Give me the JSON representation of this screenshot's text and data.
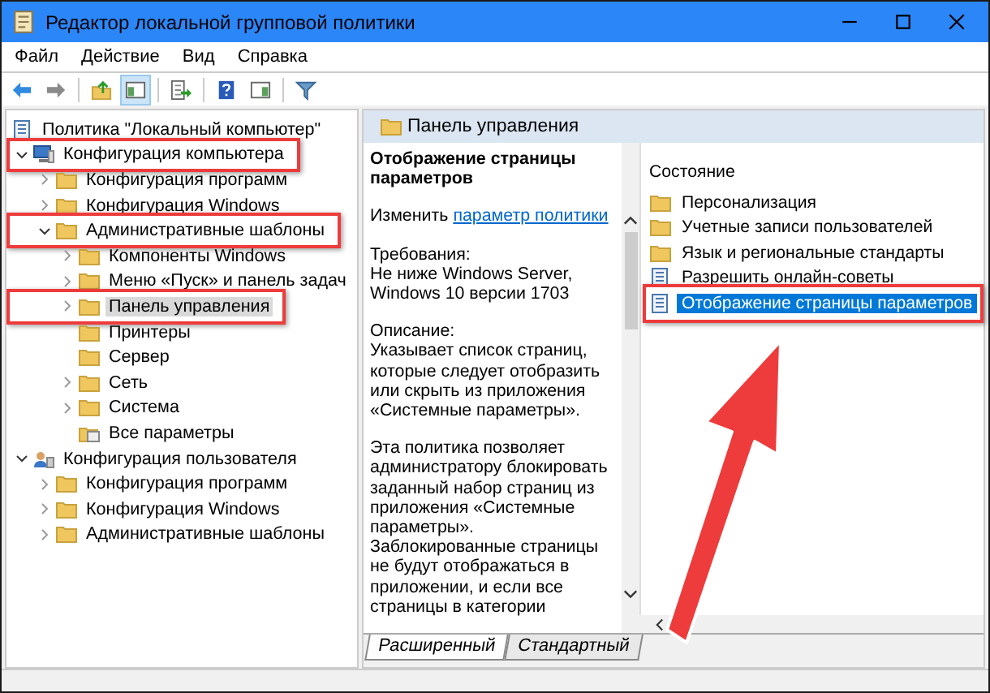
{
  "window": {
    "title": "Редактор локальной групповой политики"
  },
  "menu": [
    "Файл",
    "Действие",
    "Вид",
    "Справка"
  ],
  "toolbar": [
    {
      "kind": "back",
      "pressed": false
    },
    {
      "kind": "forward",
      "pressed": false
    },
    {
      "kind": "sep"
    },
    {
      "kind": "up",
      "pressed": false
    },
    {
      "kind": "tree",
      "pressed": true
    },
    {
      "kind": "sep"
    },
    {
      "kind": "export",
      "pressed": false
    },
    {
      "kind": "sep"
    },
    {
      "kind": "help",
      "pressed": false
    },
    {
      "kind": "pane",
      "pressed": false
    },
    {
      "kind": "sep"
    },
    {
      "kind": "filter",
      "pressed": false
    }
  ],
  "tree": {
    "items": [
      {
        "label": "Политика \"Локальный компьютер\"",
        "kind": "policy",
        "selected": false,
        "highlighted": false,
        "children": [
          {
            "label": "Конфигурация компьютера",
            "kind": "computer",
            "expanded": true,
            "selected": false,
            "highlighted": true,
            "children": [
              {
                "label": "Конфигурация программ",
                "kind": "folder",
                "expanded": false,
                "selected": false,
                "highlighted": false
              },
              {
                "label": "Конфигурация Windows",
                "kind": "folder",
                "expanded": false,
                "selected": false,
                "highlighted": false
              },
              {
                "label": "Административные шаблоны",
                "kind": "folder",
                "expanded": true,
                "selected": false,
                "highlighted": true,
                "children": [
                  {
                    "label": "Компоненты Windows",
                    "kind": "folder",
                    "expanded": false,
                    "selected": false,
                    "highlighted": false
                  },
                  {
                    "label": "Меню «Пуск» и панель задач",
                    "kind": "folder",
                    "expanded": false,
                    "selected": false,
                    "highlighted": false
                  },
                  {
                    "label": "Панель управления",
                    "kind": "folder",
                    "expanded": false,
                    "selected": true,
                    "highlighted": true
                  },
                  {
                    "label": "Принтеры",
                    "kind": "folder",
                    "selected": false,
                    "highlighted": false
                  },
                  {
                    "label": "Сервер",
                    "kind": "folder",
                    "selected": false,
                    "highlighted": false
                  },
                  {
                    "label": "Сеть",
                    "kind": "folder",
                    "expanded": false,
                    "selected": false,
                    "highlighted": false
                  },
                  {
                    "label": "Система",
                    "kind": "folder",
                    "expanded": false,
                    "selected": false,
                    "highlighted": false
                  },
                  {
                    "label": "Все параметры",
                    "kind": "settings",
                    "selected": false,
                    "highlighted": false
                  }
                ]
              }
            ]
          },
          {
            "label": "Конфигурация пользователя",
            "kind": "user",
            "expanded": true,
            "selected": false,
            "highlighted": false,
            "children": [
              {
                "label": "Конфигурация программ",
                "kind": "folder",
                "expanded": false,
                "selected": false,
                "highlighted": false
              },
              {
                "label": "Конфигурация Windows",
                "kind": "folder",
                "expanded": false,
                "selected": false,
                "highlighted": false
              },
              {
                "label": "Административные шаблоны",
                "kind": "folder",
                "expanded": false,
                "selected": false,
                "highlighted": false
              }
            ]
          }
        ]
      }
    ]
  },
  "details": {
    "header": "Панель управления",
    "title": "Отображение страницы параметров",
    "edit_text": "Изменить",
    "edit_link": "параметр политики",
    "requirements_label": "Требования:",
    "requirements": "Не ниже Windows Server, Windows 10 версии 1703",
    "description_label": "Описание:",
    "paragraphs": [
      "Указывает список страниц, которые следует отобразить или скрыть из приложения «Системные параметры».",
      "Эта политика позволяет администратору блокировать заданный набор страниц из приложения «Системные параметры». Заблокированные страницы не будут отображаться в приложении, и если все страницы в категории"
    ]
  },
  "list": {
    "column": "Состояние",
    "items": [
      {
        "label": "Персонализация",
        "kind": "folder",
        "selected": false,
        "highlighted": false
      },
      {
        "label": "Учетные записи пользователей",
        "kind": "folder",
        "selected": false,
        "highlighted": false
      },
      {
        "label": "Язык и региональные стандарты",
        "kind": "folder",
        "selected": false,
        "highlighted": false
      },
      {
        "label": "Разрешить онлайн-советы",
        "kind": "policy",
        "selected": false,
        "highlighted": false
      },
      {
        "label": "Отображение страницы параметров",
        "kind": "policy",
        "selected": true,
        "highlighted": true
      }
    ]
  },
  "tabs": [
    {
      "label": "Расширенный",
      "selected": true
    },
    {
      "label": "Стандартный",
      "selected": false
    }
  ]
}
